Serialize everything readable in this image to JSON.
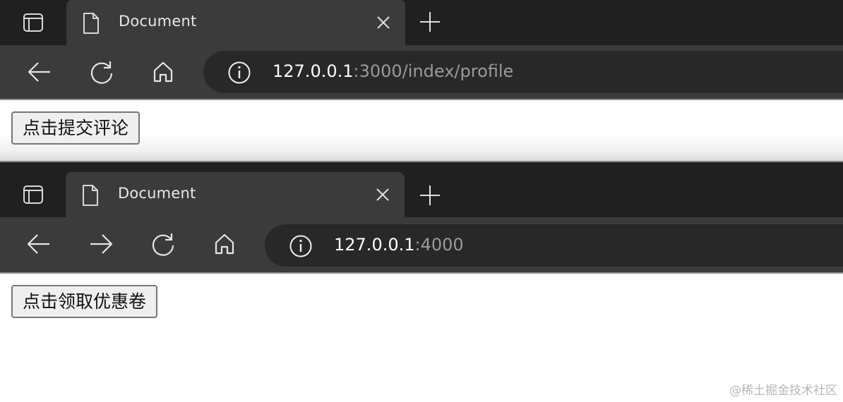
{
  "windows": [
    {
      "tab_title": "Document",
      "url_host": "127.0.0.1",
      "url_rest": ":3000/index/profile",
      "button_label": "点击提交评论",
      "nav": [
        "back",
        "reload",
        "home"
      ]
    },
    {
      "tab_title": "Document",
      "url_host": "127.0.0.1",
      "url_rest": ":4000",
      "button_label": "点击领取优惠卷",
      "nav": [
        "back",
        "forward",
        "reload",
        "home"
      ]
    }
  ],
  "watermark": "@稀土掘金技术社区",
  "colors": {
    "tabbar": "#202020",
    "tab_active": "#3b3b3b",
    "address_bar": "#282828",
    "url_host": "#ffffff",
    "url_rest": "#9a9a9a"
  },
  "icons": [
    "tab-actions-icon",
    "document-icon",
    "close-icon",
    "plus-icon",
    "back-arrow-icon",
    "forward-arrow-icon",
    "reload-icon",
    "home-icon",
    "info-icon"
  ]
}
